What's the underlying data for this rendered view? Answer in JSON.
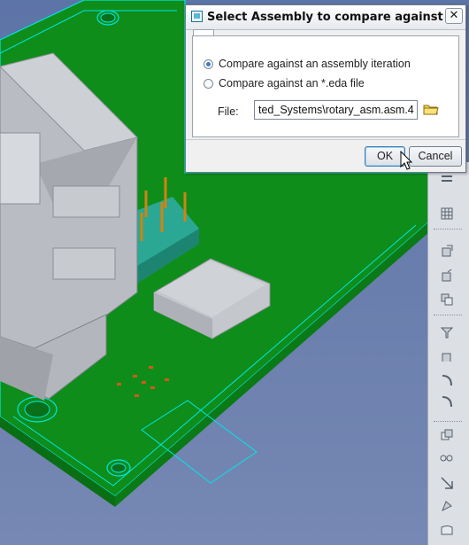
{
  "dialog": {
    "title": "Select Assembly to compare against",
    "close_label": "✕",
    "option_iteration": "Compare against an assembly iteration",
    "option_eda": "Compare against an *.eda file",
    "selected_option": "iteration",
    "file_label": "File:",
    "file_value": "ted_Systems\\rotary_asm.asm.4",
    "ok_label": "OK",
    "cancel_label": "Cancel"
  },
  "icons": {
    "title": "app-window-icon",
    "folder": "folder-icon",
    "cursor": "mouse-pointer-icon",
    "toolbar": [
      "model-tree-icon",
      "grid-view-icon",
      "view-manager-icon",
      "orient-icon",
      "copy-view-icon",
      "section-icon",
      "spin-center-icon",
      "curve-icon",
      "arc-icon",
      "arc-icon",
      "copy-icon",
      "explode-icon",
      "move-icon",
      "flex-icon",
      "annotation-icon"
    ]
  },
  "colors": {
    "background": "#6b7fae",
    "board": "#0e8d1a",
    "edge": "#00e5e5",
    "connector": "#b9bcc2",
    "header_pins": "#29b09a",
    "pins": "#d18412",
    "chip": "#bfc2c7",
    "pads": "#d15b1a",
    "toolbar": "#dcdfe4"
  }
}
